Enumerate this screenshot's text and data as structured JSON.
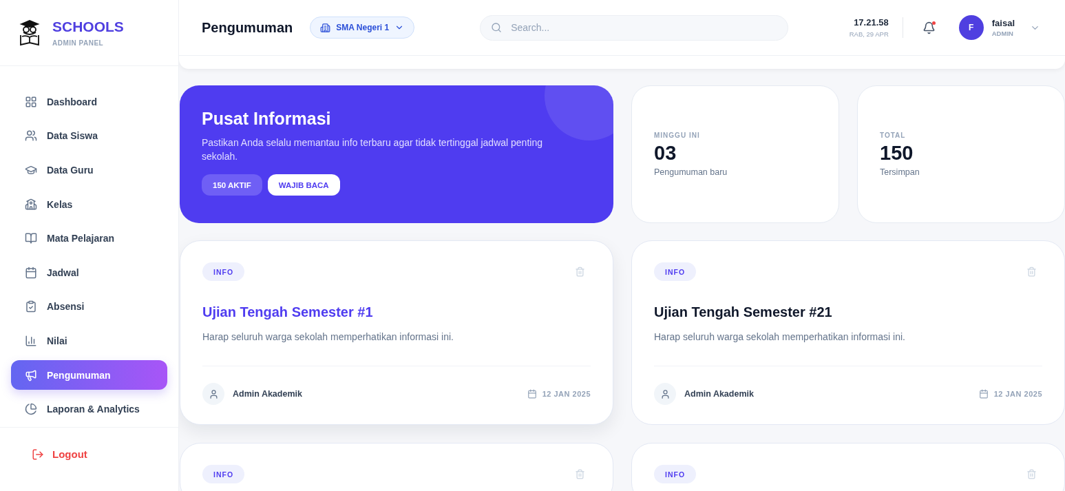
{
  "brand": {
    "title": "SCHOOLS",
    "subtitle": "ADMIN PANEL"
  },
  "sidebar": {
    "items": [
      {
        "label": "Dashboard",
        "selected": false
      },
      {
        "label": "Data Siswa",
        "selected": false
      },
      {
        "label": "Data Guru",
        "selected": false
      },
      {
        "label": "Kelas",
        "selected": false
      },
      {
        "label": "Mata Pelajaran",
        "selected": false
      },
      {
        "label": "Jadwal",
        "selected": false
      },
      {
        "label": "Absensi",
        "selected": false
      },
      {
        "label": "Nilai",
        "selected": false
      },
      {
        "label": "Pengumuman",
        "selected": true
      },
      {
        "label": "Laporan & Analytics",
        "selected": false
      }
    ],
    "logout": {
      "label": "Logout"
    }
  },
  "header": {
    "title": "Pengumuman",
    "school_selector": {
      "label": "SMA Negeri 1"
    },
    "search": {
      "placeholder": "Search..."
    },
    "clock": {
      "time": "17.21.58",
      "date": "RAB, 29 APR"
    },
    "notifications": {
      "unread": true
    },
    "user": {
      "initial": "F",
      "name": "faisal",
      "role": "ADMIN"
    }
  },
  "hero": {
    "title": "Pusat Informasi",
    "text": "Pastikan Anda selalu memantau info terbaru agar tidak tertinggal jadwal penting sekolah.",
    "badges": [
      {
        "label": "150 AKTIF",
        "kind": "filled"
      },
      {
        "label": "WAJIB BACA",
        "kind": "outline"
      }
    ]
  },
  "stats": [
    {
      "label": "MINGGU INI",
      "value": "03",
      "caption": "Pengumuman baru"
    },
    {
      "label": "TOTAL",
      "value": "150",
      "caption": "Tersimpan"
    }
  ],
  "announcements": [
    {
      "tag": "INFO",
      "title": "Ujian Tengah Semester #1",
      "text": "Harap seluruh warga sekolah memperhatikan informasi ini.",
      "author": "Admin Akademik",
      "date": "12 JAN 2025",
      "highlighted": true
    },
    {
      "tag": "INFO",
      "title": "Ujian Tengah Semester #21",
      "text": "Harap seluruh warga sekolah memperhatikan informasi ini.",
      "author": "Admin Akademik",
      "date": "12 JAN 2025",
      "highlighted": false
    },
    {
      "tag": "INFO"
    },
    {
      "tag": "INFO"
    }
  ]
}
